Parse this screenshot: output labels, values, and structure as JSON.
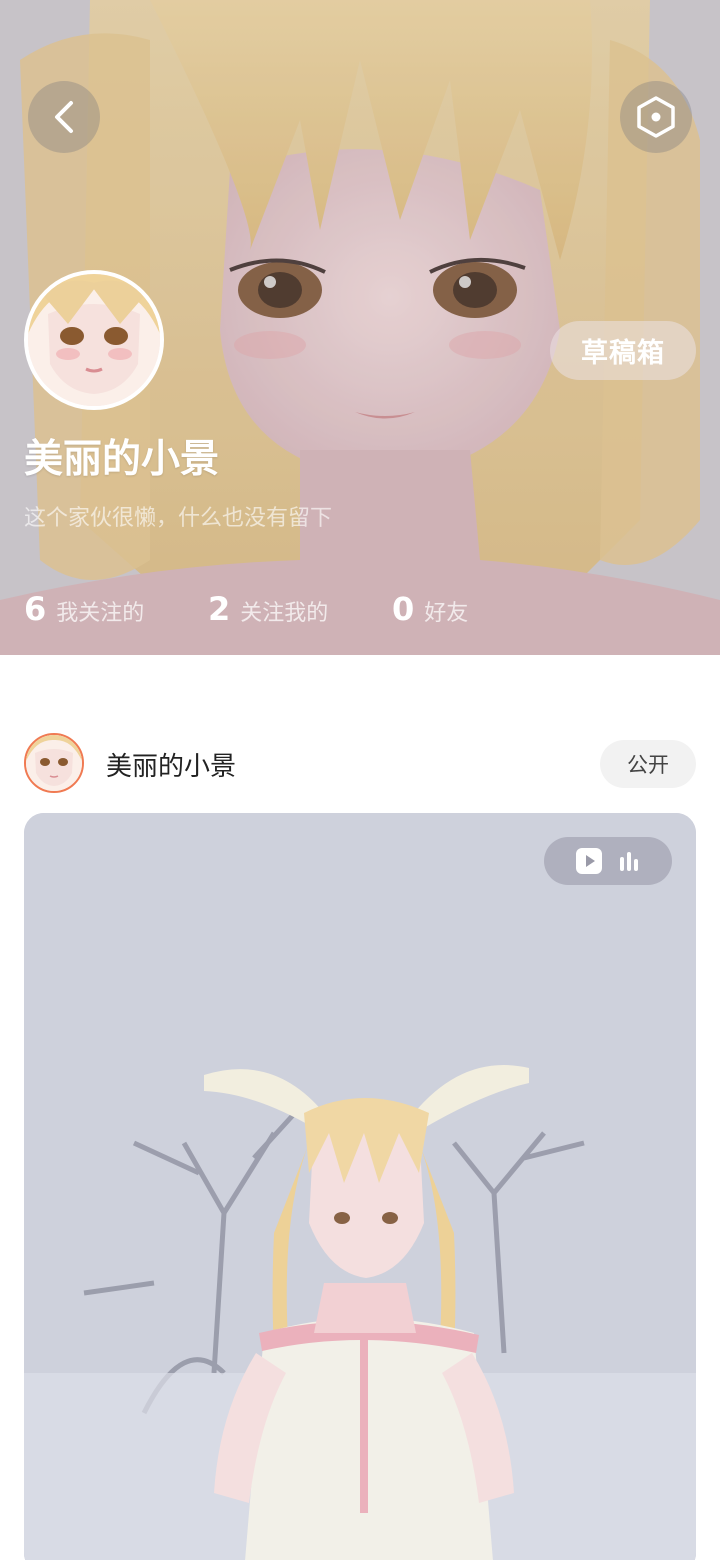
{
  "header": {
    "back_icon": "chevron-left-icon",
    "settings_icon": "hexagon-settings-icon",
    "drafts_label": "草稿箱"
  },
  "profile": {
    "name": "美丽的小景",
    "bio": "这个家伙很懒，什么也没有留下",
    "stats": [
      {
        "count": "6",
        "label": "我关注的"
      },
      {
        "count": "2",
        "label": "关注我的"
      },
      {
        "count": "0",
        "label": "好友"
      }
    ]
  },
  "post": {
    "author": "美丽的小景",
    "visibility": "公开",
    "media_badge_icons": [
      "play-video-icon",
      "audio-bars-icon"
    ]
  },
  "colors": {
    "accent_ring": "#f07a52",
    "tag_bg": "#f2f2f2"
  }
}
